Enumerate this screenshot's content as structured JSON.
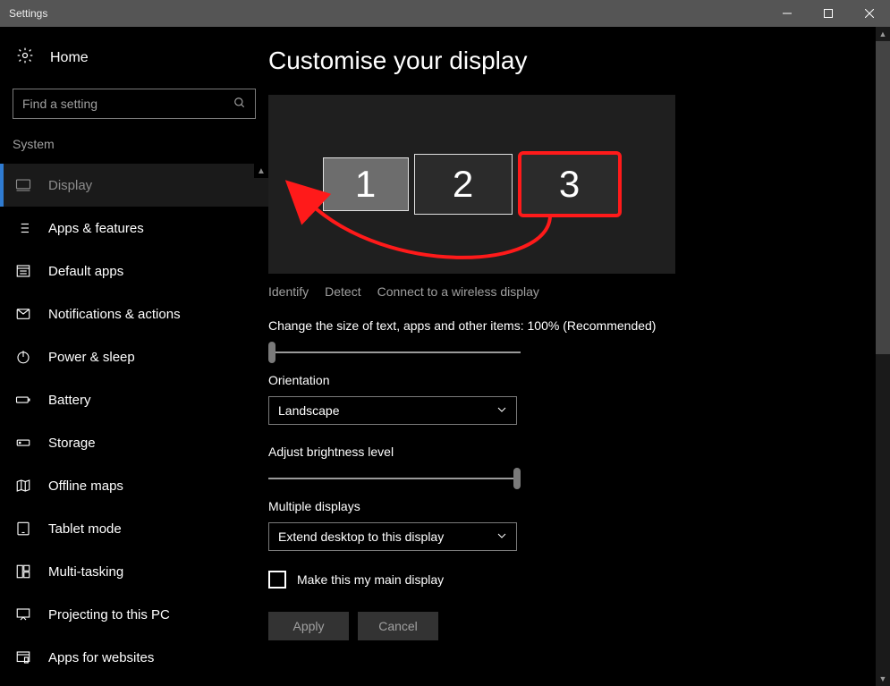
{
  "window": {
    "title": "Settings"
  },
  "sidebar": {
    "home": "Home",
    "search_placeholder": "Find a setting",
    "section": "System",
    "items": [
      {
        "label": "Display"
      },
      {
        "label": "Apps & features"
      },
      {
        "label": "Default apps"
      },
      {
        "label": "Notifications & actions"
      },
      {
        "label": "Power & sleep"
      },
      {
        "label": "Battery"
      },
      {
        "label": "Storage"
      },
      {
        "label": "Offline maps"
      },
      {
        "label": "Tablet mode"
      },
      {
        "label": "Multi-tasking"
      },
      {
        "label": "Projecting to this PC"
      },
      {
        "label": "Apps for websites"
      }
    ]
  },
  "main": {
    "heading": "Customise your display",
    "monitors": {
      "m1": "1",
      "m2": "2",
      "m3": "3"
    },
    "links": {
      "identify": "Identify",
      "detect": "Detect",
      "connect": "Connect to a wireless display"
    },
    "scale_label": "Change the size of text, apps and other items: 100% (Recommended)",
    "orientation_label": "Orientation",
    "orientation_value": "Landscape",
    "brightness_label": "Adjust brightness level",
    "multiple_label": "Multiple displays",
    "multiple_value": "Extend desktop to this display",
    "main_display_label": "Make this my main display",
    "apply": "Apply",
    "cancel": "Cancel"
  }
}
